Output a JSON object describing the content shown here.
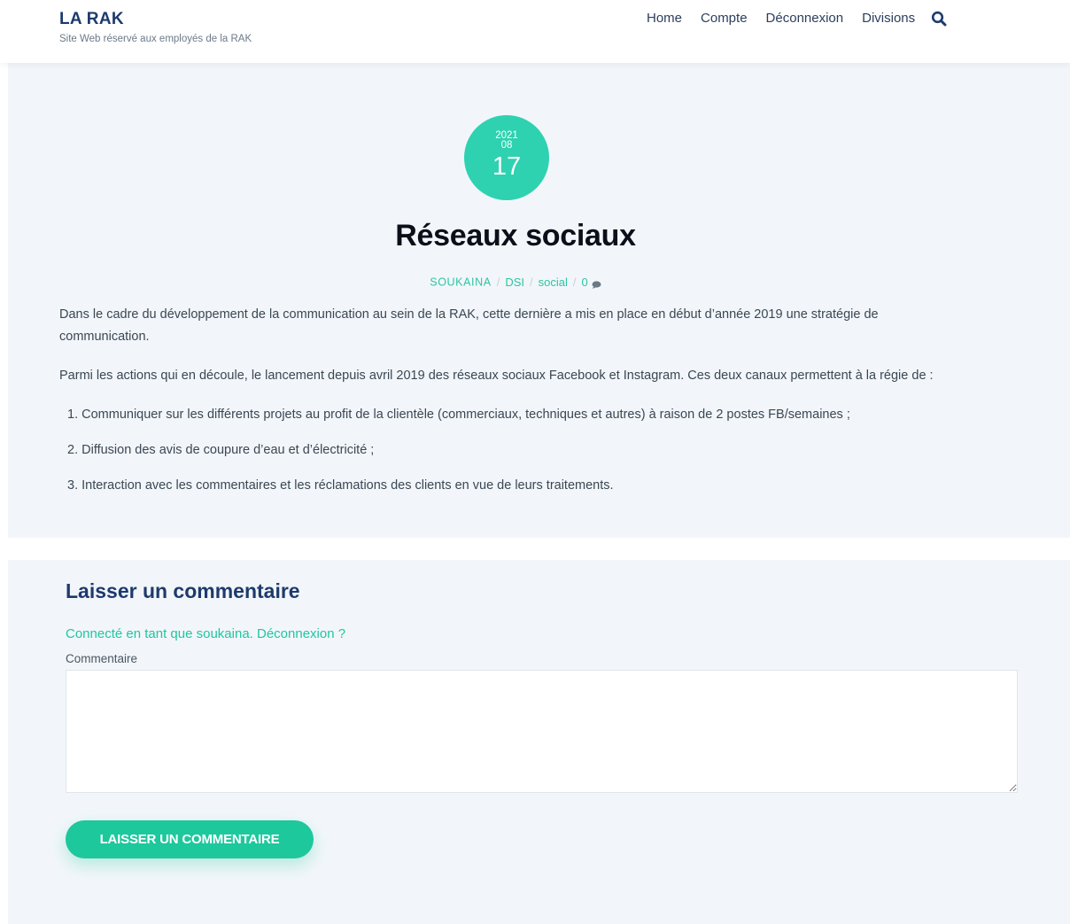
{
  "header": {
    "site_title": "LA RAK",
    "site_description": "Site Web réservé aux employés de la RAK",
    "nav": [
      "Home",
      "Compte",
      "Déconnexion",
      "Divisions"
    ],
    "search_icon": "search-icon"
  },
  "post": {
    "date": {
      "year": "2021",
      "month": "08",
      "day": "17"
    },
    "title": "Réseaux sociaux",
    "meta": {
      "author": "SOUKAINA",
      "category": "DSI",
      "tag": "social",
      "comment_count": "0"
    },
    "paragraphs": [
      "Dans le cadre du développement de la communication au sein de la RAK, cette dernière a mis en place en début d’année 2019 une stratégie de communication.",
      "Parmi les actions qui en découle, le lancement depuis avril 2019 des réseaux sociaux Facebook et Instagram. Ces deux canaux permettent à la régie de :"
    ],
    "list": [
      "1. Communiquer sur les différents projets au profit de la clientèle (commerciaux, techniques et autres) à raison de 2 postes FB/semaines ;",
      "2. Diffusion des avis de coupure d’eau et d’électricité ;",
      "3. Interaction avec les commentaires et les réclamations des clients en vue de leurs traitements."
    ]
  },
  "comments": {
    "title": "Laisser un commentaire",
    "logged_in_text": "Connecté en tant que soukaina.",
    "logout_link": "Déconnexion ?",
    "comment_label": "Commentaire",
    "comment_value": "",
    "submit_label": "LAISSER UN COMMENTAIRE"
  },
  "colors": {
    "accent": "#2ed2b0",
    "title": "#1e3a6d",
    "background": "#f2f6fa"
  }
}
